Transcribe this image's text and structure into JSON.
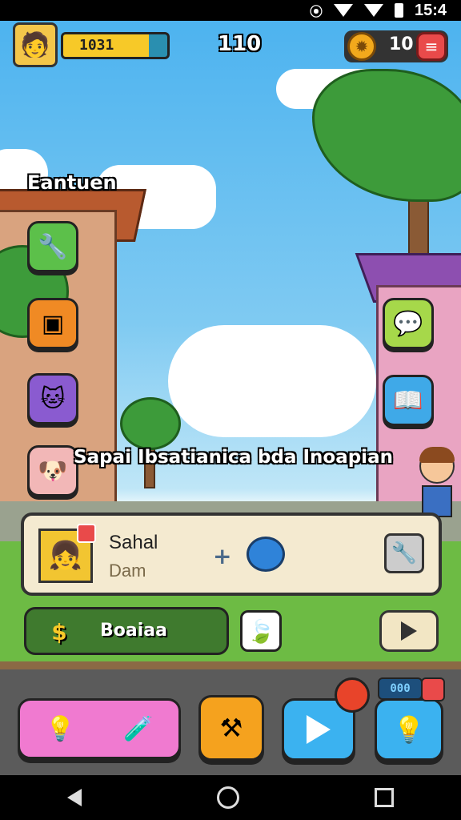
{
  "status_bar": {
    "time": "15:4",
    "icons": [
      "signal-icon",
      "wifi-icon",
      "wifi-icon",
      "battery-icon"
    ]
  },
  "hud": {
    "xp_text": "1031",
    "xp_fraction": 0.82,
    "center_value": "110",
    "coins": "10",
    "coin_icon": "gear-icon",
    "menu_icon": "menu-icon"
  },
  "location": {
    "title": "Eantuen"
  },
  "side_buttons": {
    "left": [
      {
        "icon": "wrench-icon",
        "color": "#5cc04a",
        "glyph": "🔧"
      },
      {
        "icon": "frame-icon",
        "color": "#f08a24",
        "glyph": "▣"
      },
      {
        "icon": "cat-icon",
        "color": "#8a5bd0",
        "glyph": "🐱"
      },
      {
        "icon": "dog-icon",
        "color": "#f2b7b7",
        "glyph": "🐶"
      }
    ],
    "right": [
      {
        "icon": "chat-icon",
        "color": "#a6d84a",
        "glyph": "💬"
      },
      {
        "icon": "book-icon",
        "color": "#3fa9e8",
        "glyph": "📖"
      }
    ]
  },
  "banner": {
    "text": "Sapai Ibsatianica bda Inoapian"
  },
  "character_panel": {
    "name": "Sahal",
    "subtitle": "Dam",
    "plus": "+",
    "avatar_glyph": "👧",
    "tool_glyph": "🔧"
  },
  "quest": {
    "icon_text": "$",
    "label": "Boaiaa"
  },
  "dock": {
    "badge": "000",
    "buttons": [
      {
        "name": "inventory-button",
        "color": "#f07ad0"
      },
      {
        "name": "tools-button",
        "color": "#f5a21e"
      },
      {
        "name": "play-button",
        "color": "#3bb2f0"
      },
      {
        "name": "hint-button",
        "color": "#3bb2f0"
      }
    ]
  },
  "colors": {
    "sky": "#4db3ef",
    "grass": "#6dbb44",
    "panel": "#f4ead0",
    "accent_red": "#e94a4a"
  }
}
